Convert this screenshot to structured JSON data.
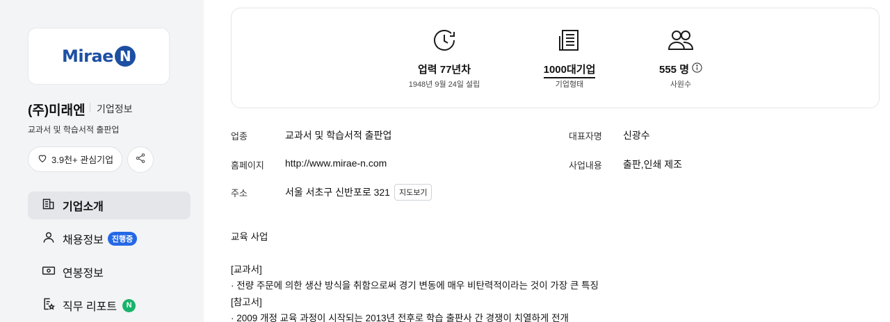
{
  "company": {
    "logo_text": "Mirae",
    "logo_letter": "N",
    "name": "(주)미래엔",
    "tag": "기업정보",
    "description": "교과서 및 학습서적 출판업",
    "favorite_label": "3.9천+ 관심기업"
  },
  "nav": {
    "items": [
      {
        "label": "기업소개",
        "icon": "building-doc-icon",
        "active": true
      },
      {
        "label": "채용정보",
        "icon": "person-icon",
        "badge": "진행중"
      },
      {
        "label": "연봉정보",
        "icon": "money-icon"
      },
      {
        "label": "직무 리포트",
        "icon": "report-star-icon",
        "badge": "N"
      }
    ]
  },
  "stats": [
    {
      "icon": "clock-icon",
      "value": "업력 77년차",
      "sub": "1948년 9월 24일 설립"
    },
    {
      "icon": "newspaper-icon",
      "value": "1000대기업",
      "sub": "기업형태"
    },
    {
      "icon": "people-icon",
      "value": "555 명",
      "sub": "사원수",
      "info_icon": "info-icon"
    }
  ],
  "info": {
    "industry_label": "업종",
    "industry_value": "교과서 및 학습서적 출판업",
    "ceo_label": "대표자명",
    "ceo_value": "신광수",
    "homepage_label": "홈페이지",
    "homepage_value": "http://www.mirae-n.com",
    "business_label": "사업내용",
    "business_value": "출판,인쇄 제조",
    "address_label": "주소",
    "address_value": "서울 서초구 신반포로 321",
    "map_button": "지도보기"
  },
  "description": {
    "lines": [
      "교육 사업",
      "[교과서]",
      "· 전량 주문에 의한 생산 방식을 취함으로써 경기 변동에 매우 비탄력적이라는 것이 가장 큰 특징",
      "[참고서]",
      "· 2009 개정 교육 과정이 시작되는 2013년 전후로 학습 출판사 간 경쟁이 치열하게 전개"
    ]
  },
  "colors": {
    "brand": "#1d4fa3",
    "badge_blue": "#2468e5",
    "badge_green": "#19b36b",
    "sidebar_bg": "#f3f4f6"
  }
}
